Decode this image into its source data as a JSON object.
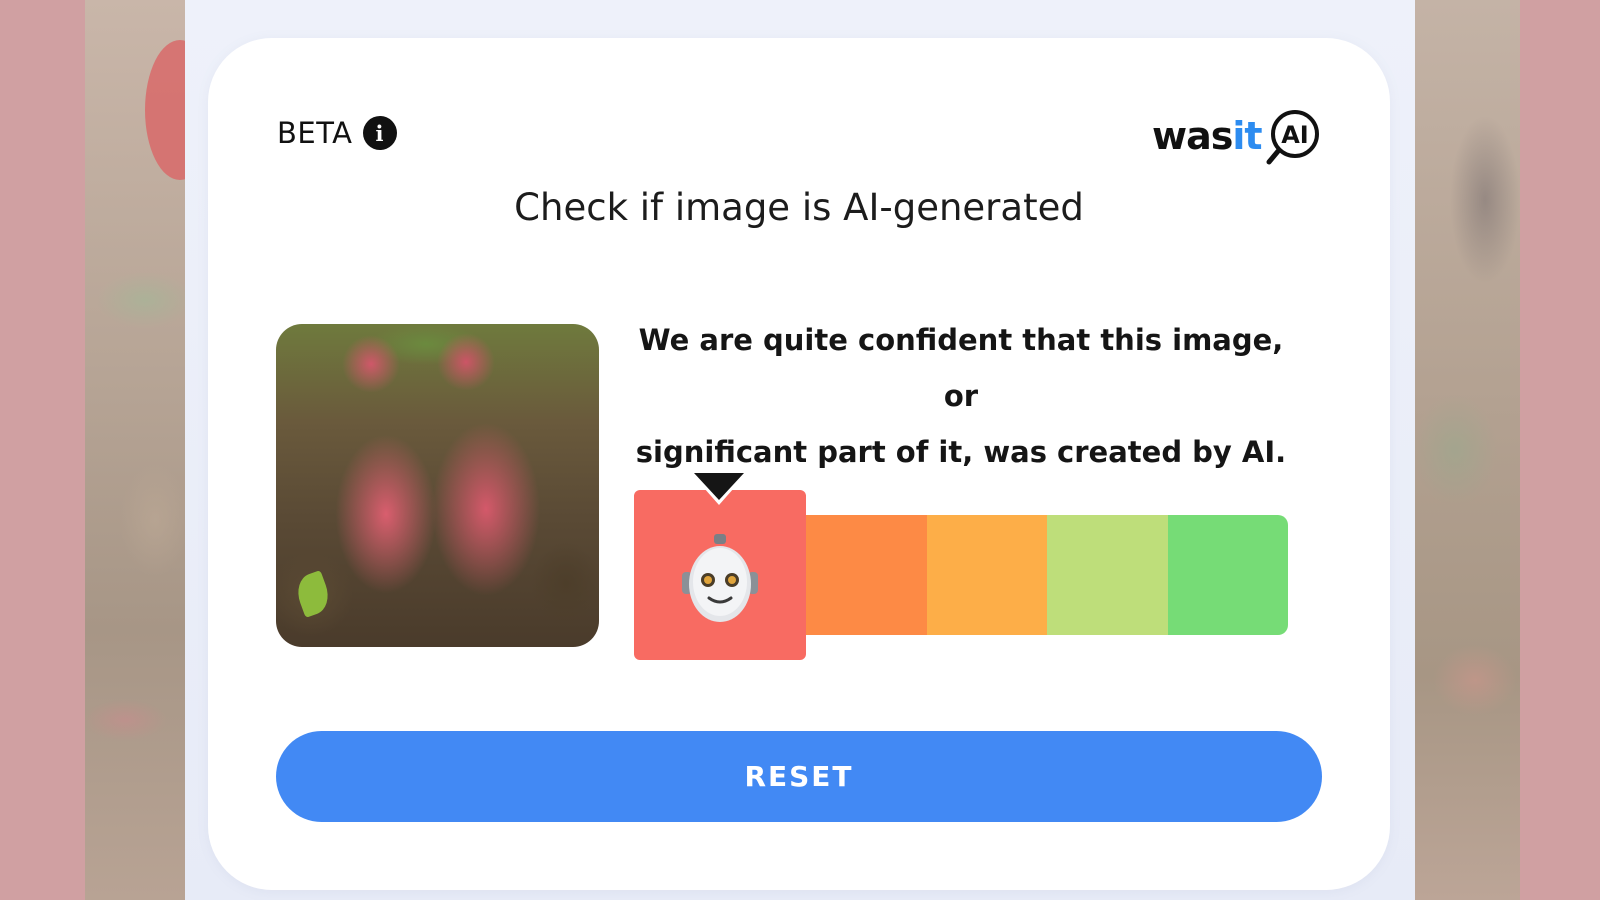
{
  "header": {
    "beta_label": "BETA",
    "info_icon": "info-icon",
    "logo": {
      "prefix": "was",
      "accent": "it",
      "badge": "AI"
    }
  },
  "title": "Check if image is AI-generated",
  "result": {
    "verdict_line1": "We are quite confident that this image, or",
    "verdict_line2": "significant part of it, was created by AI.",
    "meter": {
      "active_icon": "robot-icon",
      "active_index": 0,
      "segment_count": 5,
      "colors": [
        "#f86b62",
        "#fd8a45",
        "#fdae48",
        "#bede7a",
        "#76dc76"
      ]
    }
  },
  "reset_label": "RESET",
  "colors": {
    "accent_blue": "#4289f4",
    "logo_blue": "#2d8cf0",
    "card_bg": "#ffffff",
    "panel_bg": "#eef1fa"
  }
}
